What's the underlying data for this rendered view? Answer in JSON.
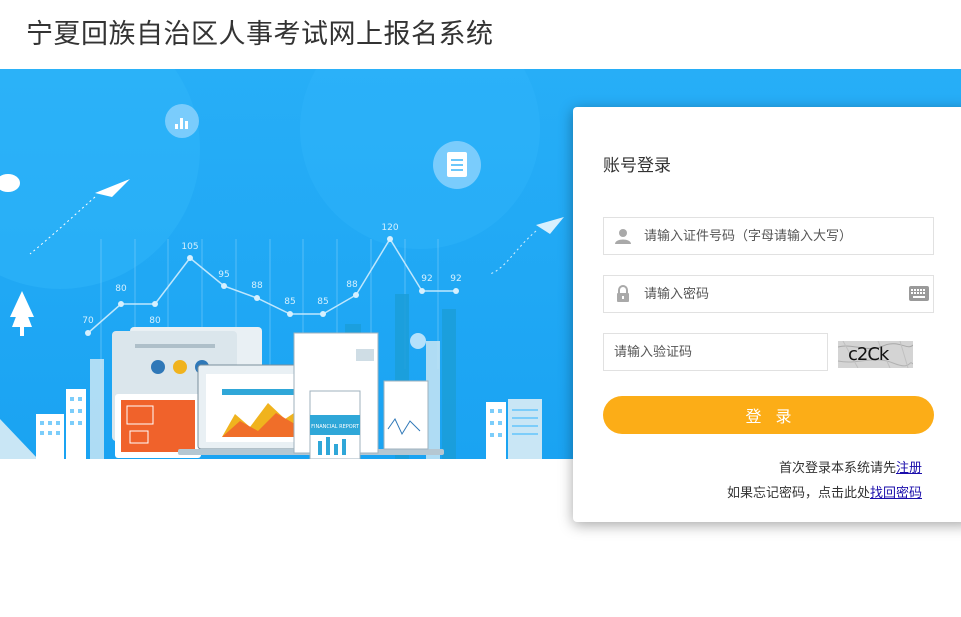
{
  "header": {
    "title": "宁夏回族自治区人事考试网上报名系统"
  },
  "banner": {
    "chart_labels": [
      "70",
      "80",
      "80",
      "105",
      "95",
      "88",
      "85",
      "85",
      "88",
      "120",
      "92",
      "92"
    ],
    "report_label": "FINANCIAL REPORT"
  },
  "login": {
    "title": "账号登录",
    "id_placeholder": "请输入证件号码（字母请输入大写）",
    "password_placeholder": "请输入密码",
    "code_placeholder": "请输入验证码",
    "captcha_text": "c2Ck",
    "submit_label": "登录",
    "register_prefix": "首次登录本系统请先",
    "register_link": "注册",
    "forgot_prefix": "如果忘记密码，点击此处",
    "forgot_link": "找回密码"
  },
  "colors": {
    "banner": "#1aa3f2",
    "button": "#fcad17",
    "link": "#1a0dab"
  }
}
